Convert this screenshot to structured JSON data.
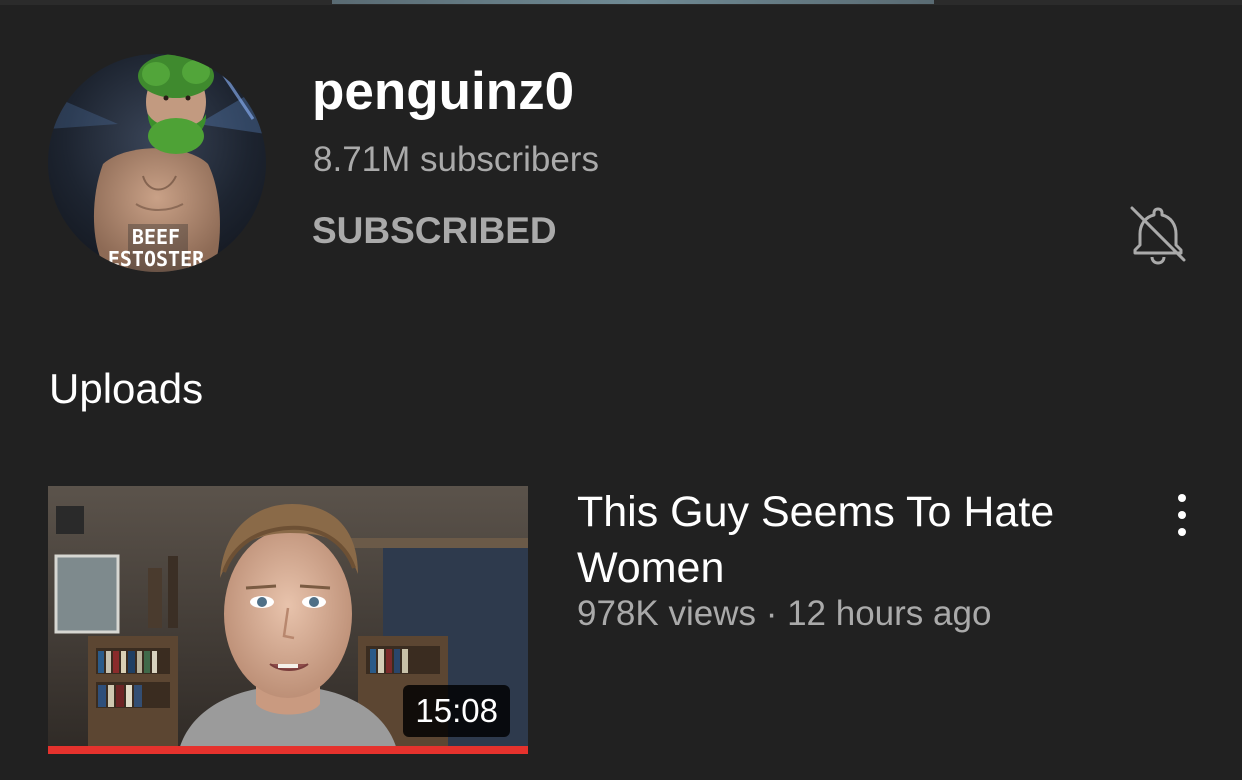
{
  "channel": {
    "name": "penguinz0",
    "subscribers": "8.71M subscribers",
    "subscribe_label": "SUBSCRIBED",
    "avatar_text_line1": "BEEF",
    "avatar_text_line2": "ESTOSTER",
    "notification_icon": "bell-off-icon"
  },
  "uploads": {
    "title": "Uploads",
    "videos": [
      {
        "title": "This Guy Seems To Hate Women",
        "meta": "978K views · 12 hours ago",
        "duration": "15:08",
        "watch_progress": 1.0,
        "menu_icon": "more-vert-icon"
      }
    ]
  },
  "colors": {
    "background": "#212121",
    "primary_text": "#ffffff",
    "secondary_text": "#aaaaaa",
    "progress": "#e5322d"
  }
}
